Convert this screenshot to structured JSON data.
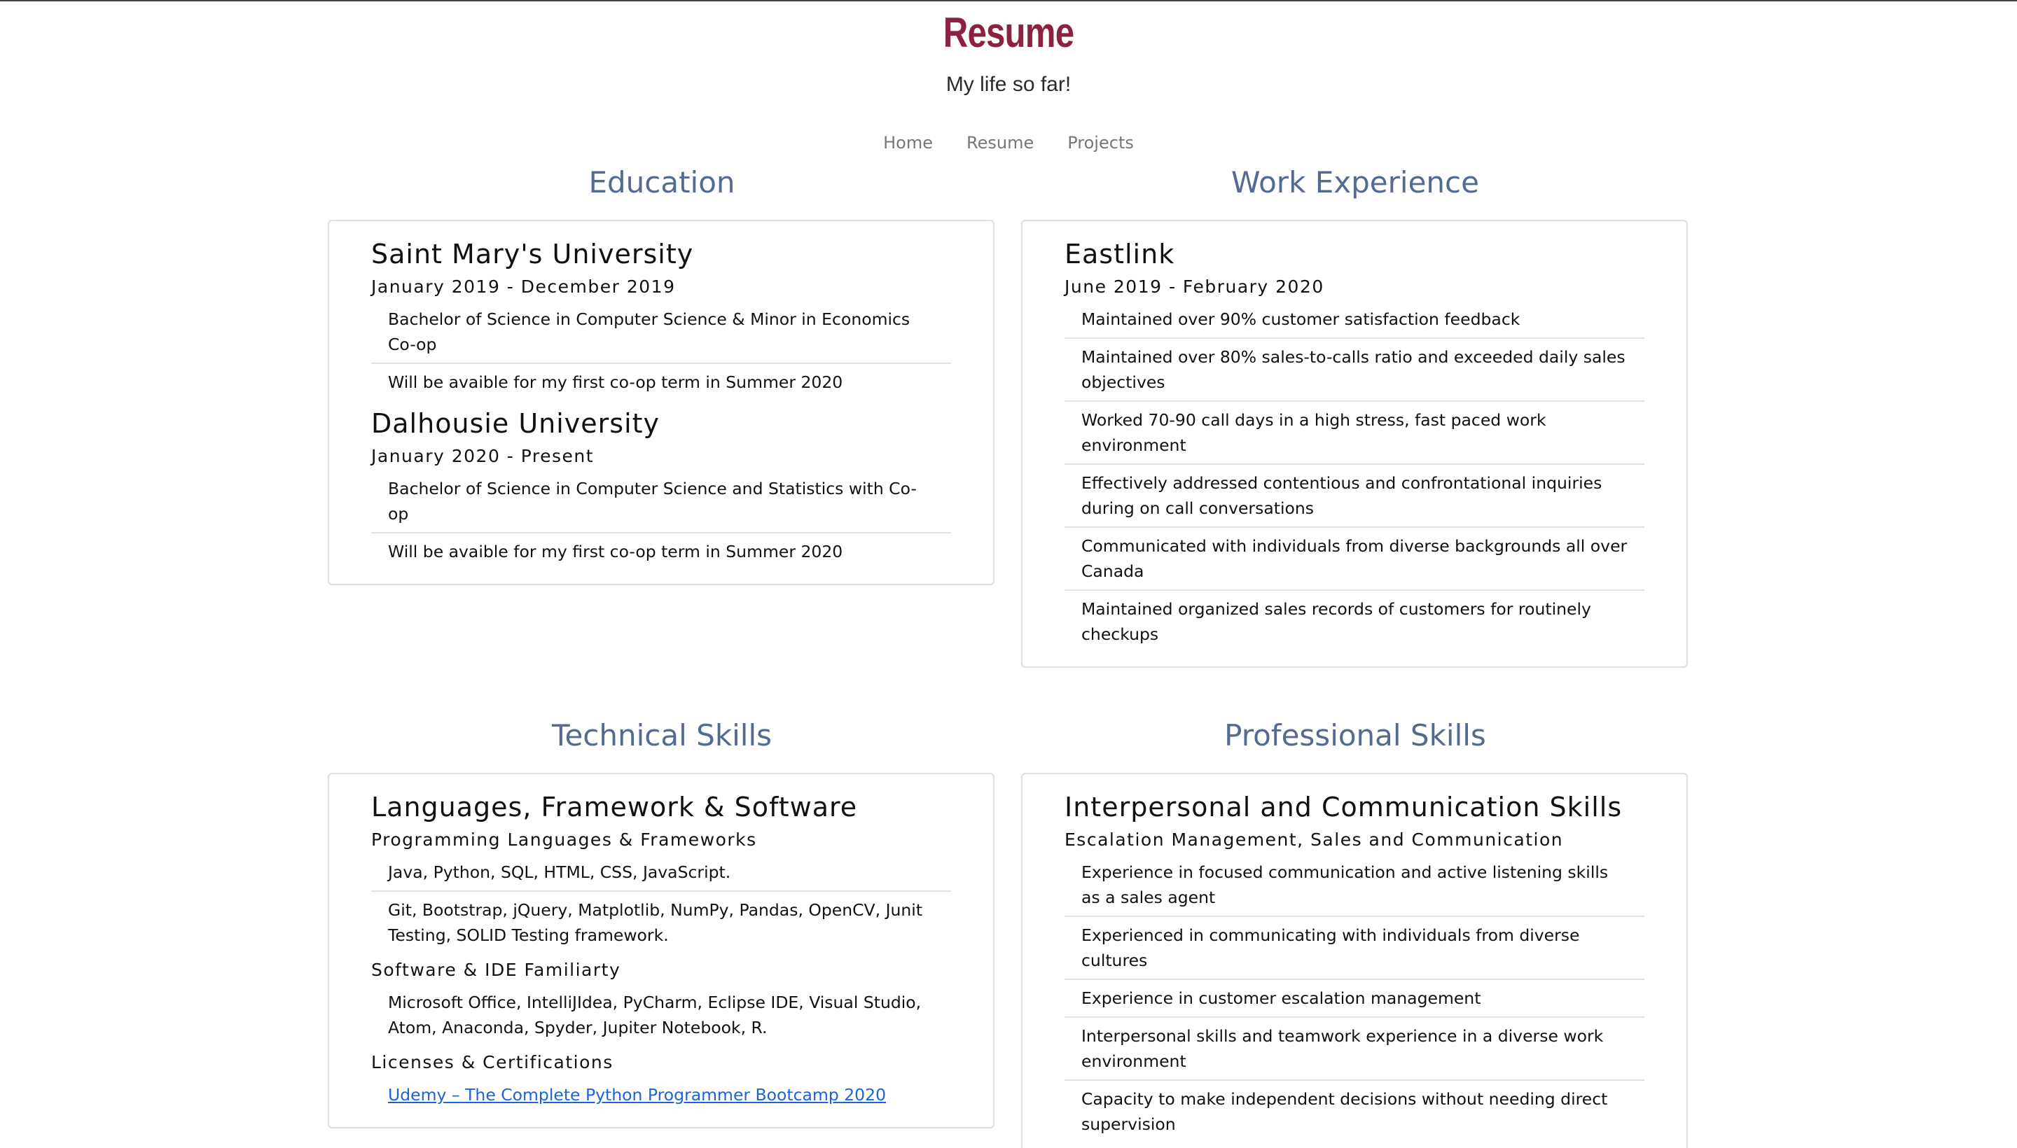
{
  "header": {
    "title": "Resume",
    "subtitle": "My life so far!"
  },
  "nav": {
    "items": [
      {
        "label": "Home"
      },
      {
        "label": "Resume"
      },
      {
        "label": "Projects"
      }
    ]
  },
  "education": {
    "heading": "Education",
    "schools": [
      {
        "name": "Saint Mary's University",
        "dates": "January 2019 - December 2019",
        "items": [
          "Bachelor of Science in Computer Science & Minor in Economics Co-op",
          "Will be avaible for my first co-op term in Summer 2020"
        ]
      },
      {
        "name": "Dalhousie University",
        "dates": "January 2020 - Present",
        "items": [
          "Bachelor of Science in Computer Science and Statistics with Co-op",
          "Will be avaible for my first co-op term in Summer 2020"
        ]
      }
    ]
  },
  "work": {
    "heading": "Work Experience",
    "jobs": [
      {
        "company": "Eastlink",
        "dates": "June 2019 - February 2020",
        "items": [
          "Maintained over 90% customer satisfaction feedback",
          "Maintained over 80% sales-to-calls ratio and exceeded daily sales objectives",
          "Worked 70-90 call days in a high stress, fast paced work environment",
          "Effectively addressed contentious and confrontational inquiries during on call conversations",
          "Communicated with individuals from diverse backgrounds all over Canada",
          "Maintained organized sales records of customers for routinely checkups"
        ]
      }
    ]
  },
  "technical": {
    "heading": "Technical Skills",
    "title": "Languages, Framework & Software",
    "groups": [
      {
        "label": "Programming Languages & Frameworks",
        "items": [
          "Java, Python, SQL, HTML, CSS, JavaScript.",
          "Git, Bootstrap, jQuery, Matplotlib, NumPy, Pandas, OpenCV, Junit Testing, SOLID Testing framework."
        ]
      },
      {
        "label": "Software & IDE Familiarty",
        "items": [
          "Microsoft Office, IntelliJIdea, PyCharm, Eclipse IDE, Visual Studio, Atom, Anaconda, Spyder, Jupiter Notebook, R."
        ]
      },
      {
        "label": "Licenses & Certifications",
        "link": "Udemy – The Complete Python Programmer Bootcamp 2020"
      }
    ]
  },
  "professional": {
    "heading": "Professional Skills",
    "title": "Interpersonal and Communication Skills",
    "subtitle": "Escalation Management, Sales and Communication",
    "items": [
      "Experience in focused communication and active listening skills as a sales agent",
      "Experienced in communicating with individuals from diverse cultures",
      "Experience in customer escalation management",
      "Interpersonal skills and teamwork experience in a diverse work environment",
      "Capacity to make independent decisions without needing direct supervision"
    ]
  },
  "colors": {
    "title": "#8b2340",
    "heading": "#546a91",
    "link": "#1a63d8"
  }
}
